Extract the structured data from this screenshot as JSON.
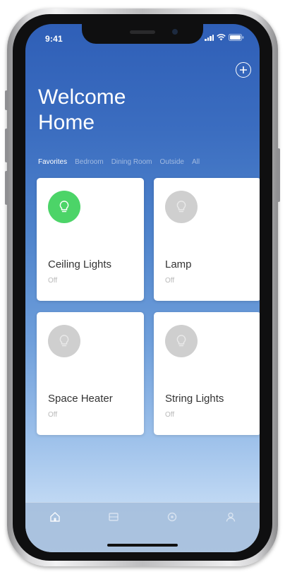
{
  "status_bar": {
    "time": "9:41"
  },
  "header": {
    "add_icon": "plus-circle-icon",
    "title": "Welcome Home"
  },
  "room_tabs": [
    {
      "label": "Favorites",
      "active": true
    },
    {
      "label": "Bedroom",
      "active": false
    },
    {
      "label": "Dining Room",
      "active": false
    },
    {
      "label": "Outside",
      "active": false
    },
    {
      "label": "All",
      "active": false
    }
  ],
  "devices": [
    {
      "name": "Ceiling Lights",
      "status": "Off",
      "icon": "lightbulb-icon",
      "highlighted": true,
      "icon_color": "#4cd468"
    },
    {
      "name": "Lamp",
      "status": "Off",
      "icon": "lightbulb-icon",
      "highlighted": false,
      "icon_color": "#cfcfcf"
    },
    {
      "name": "Space Heater",
      "status": "Off",
      "icon": "lightbulb-icon",
      "highlighted": false,
      "icon_color": "#cfcfcf"
    },
    {
      "name": "String Lights",
      "status": "Off",
      "icon": "lightbulb-icon",
      "highlighted": false,
      "icon_color": "#cfcfcf"
    }
  ],
  "bottom_tabs": [
    {
      "icon": "home-icon",
      "active": true
    },
    {
      "icon": "rooms-icon",
      "active": false
    },
    {
      "icon": "scenes-icon",
      "active": false
    },
    {
      "icon": "profile-icon",
      "active": false
    }
  ],
  "colors": {
    "accent_blue": "#2f5fb7",
    "on_green": "#4cd468"
  }
}
